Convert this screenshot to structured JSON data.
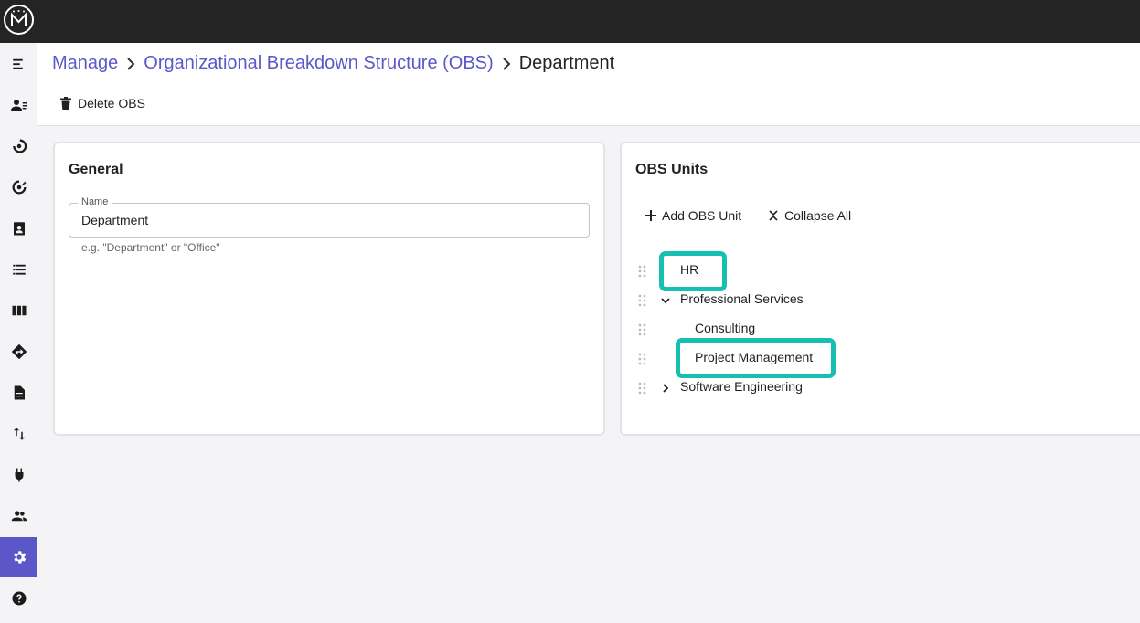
{
  "app": {
    "logo_icon": "crown-m-logo-icon"
  },
  "sidebar": {
    "active_index": 12,
    "accent_color": "#5c57c9",
    "items": [
      {
        "icon": "menu-icon"
      },
      {
        "icon": "resources-icon"
      },
      {
        "icon": "progress-icon"
      },
      {
        "icon": "target-icon"
      },
      {
        "icon": "assignment-icon"
      },
      {
        "icon": "list-icon"
      },
      {
        "icon": "board-icon"
      },
      {
        "icon": "roadmap-icon"
      },
      {
        "icon": "document-icon"
      },
      {
        "icon": "transfer-icon"
      },
      {
        "icon": "plugin-icon"
      },
      {
        "icon": "users-icon"
      },
      {
        "icon": "settings-icon"
      },
      {
        "icon": "help-icon"
      }
    ]
  },
  "breadcrumb": {
    "items": [
      "Manage",
      "Organizational Breakdown Structure (OBS)"
    ],
    "current": "Department"
  },
  "toolbar": {
    "delete_label": "Delete OBS"
  },
  "general": {
    "title": "General",
    "name_label": "Name",
    "name_value": "Department",
    "name_hint": "e.g. \"Department\" or \"Office\""
  },
  "obs": {
    "title": "OBS Units",
    "add_label": "Add OBS Unit",
    "collapse_label": "Collapse All",
    "highlight_color": "#16bfb1",
    "nodes": [
      {
        "label": "HR",
        "level": 0,
        "expander": "none",
        "highlighted": true
      },
      {
        "label": "Professional Services",
        "level": 0,
        "expander": "expanded",
        "highlighted": false
      },
      {
        "label": "Consulting",
        "level": 1,
        "expander": "none",
        "highlighted": false
      },
      {
        "label": "Project Management",
        "level": 1,
        "expander": "none",
        "highlighted": true
      },
      {
        "label": "Software Engineering",
        "level": 0,
        "expander": "collapsed",
        "highlighted": false
      }
    ]
  }
}
